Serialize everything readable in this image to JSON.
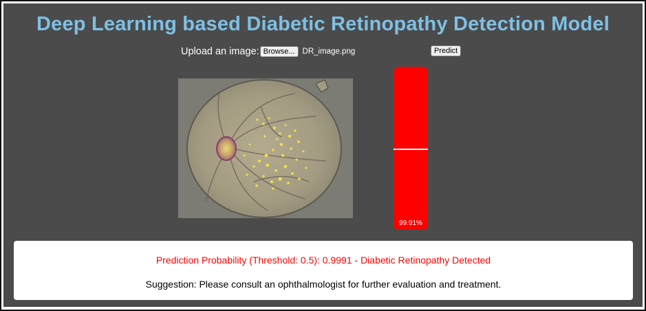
{
  "header": {
    "title": "Deep Learning based Diabetic Retinopathy Detection Model"
  },
  "upload": {
    "label": "Upload an image:",
    "browse_label": "Browse...",
    "file_name": "DR_image.png",
    "predict_label": "Predict"
  },
  "image": {
    "kind": "retinal-fundus-image"
  },
  "gauge": {
    "value": 0.9991,
    "threshold": 0.5,
    "label": "99.91%",
    "color": "#ff0000"
  },
  "result": {
    "prediction_text": "Prediction Probability (Threshold: 0.5): 0.9991 - Diabetic Retinopathy Detected",
    "suggestion_text": "Suggestion: Please consult an ophthalmologist for further evaluation and treatment."
  },
  "colors": {
    "background": "#4b4b4b",
    "title": "#7ec0e6",
    "alert": "#ff0000"
  }
}
